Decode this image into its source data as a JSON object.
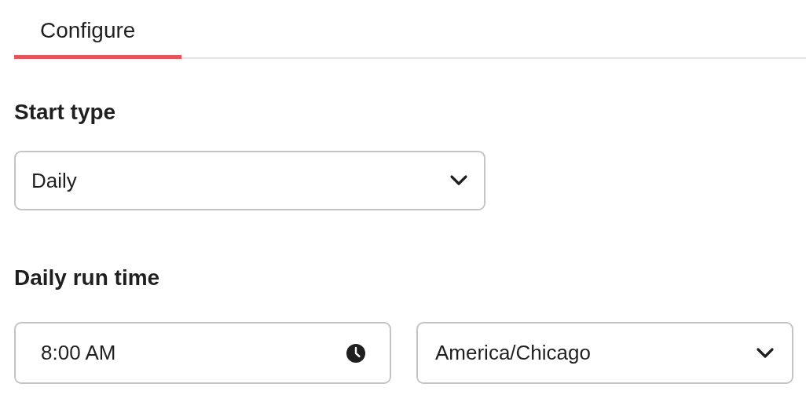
{
  "tabs": [
    {
      "label": "Configure",
      "selected": true
    }
  ],
  "start_type": {
    "label": "Start type",
    "value": "Daily"
  },
  "daily_run_time": {
    "label": "Daily run time",
    "time": "8:00 AM",
    "timezone": "America/Chicago"
  }
}
